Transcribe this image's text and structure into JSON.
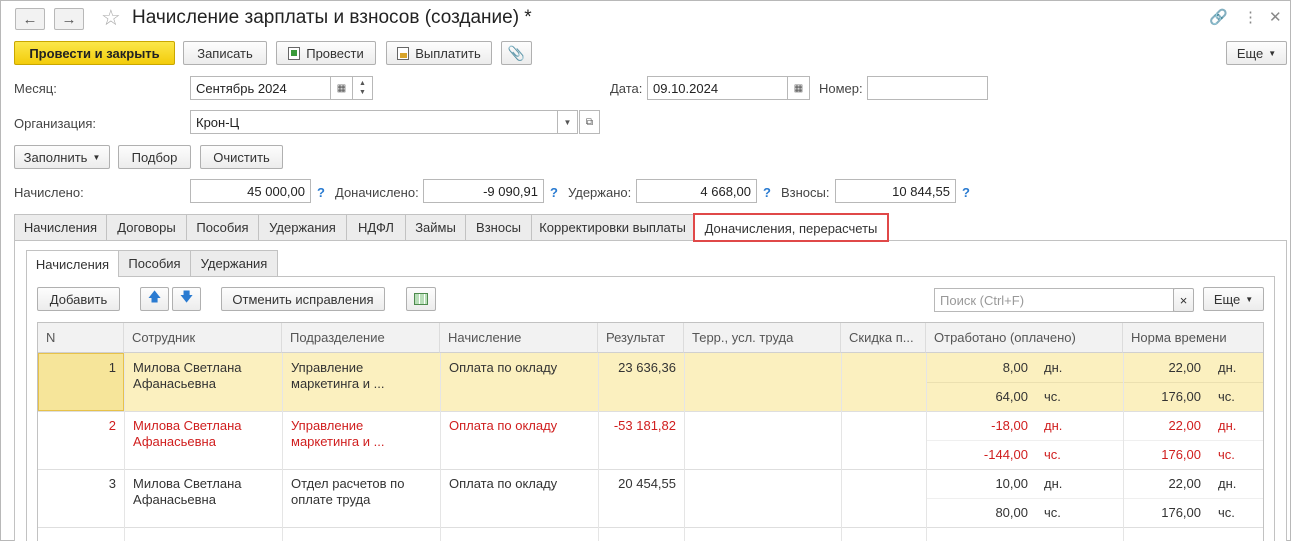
{
  "header": {
    "title": "Начисление зарплаты и взносов (создание) *",
    "icons": [
      "arrow-left-icon",
      "arrow-right-icon",
      "star-icon",
      "link-icon",
      "more-icon",
      "close-icon"
    ]
  },
  "toolbar": {
    "post_close": "Провести и закрыть",
    "save": "Записать",
    "post": "Провести",
    "pay": "Выплатить",
    "more": "Еще"
  },
  "form": {
    "month_label": "Месяц:",
    "month_value": "Сентябрь 2024",
    "date_label": "Дата:",
    "date_value": "09.10.2024",
    "number_label": "Номер:",
    "number_value": "",
    "org_label": "Организация:",
    "org_value": "Крон-Ц"
  },
  "actions": {
    "fill": "Заполнить",
    "select": "Подбор",
    "clear": "Очистить"
  },
  "totals": {
    "accrued_label": "Начислено:",
    "accrued_value": "45 000,00",
    "additional_label": "Доначислено:",
    "additional_value": "-9 090,91",
    "withheld_label": "Удержано:",
    "withheld_value": "4 668,00",
    "contrib_label": "Взносы:",
    "contrib_value": "10 844,55",
    "help": "?"
  },
  "tabs": [
    "Начисления",
    "Договоры",
    "Пособия",
    "Удержания",
    "НДФЛ",
    "Займы",
    "Взносы",
    "Корректировки выплаты",
    "Доначисления, перерасчеты"
  ],
  "subtabs": [
    "Начисления",
    "Пособия",
    "Удержания"
  ],
  "subtoolbar": {
    "add": "Добавить",
    "cancel_fix": "Отменить исправления",
    "search_placeholder": "Поиск (Ctrl+F)",
    "clear": "×",
    "more": "Еще"
  },
  "columns": [
    "N",
    "Сотрудник",
    "Подразделение",
    "Начисление",
    "Результат",
    "Терр., усл. труда",
    "Скидка п...",
    "Отработано (оплачено)",
    "Норма времени"
  ],
  "rows": [
    {
      "n": "1",
      "employee1": "Милова Светлана",
      "employee2": "Афанасьевна",
      "dept1": "Управление",
      "dept2": "маркетинга и ...",
      "accrual": "Оплата по окладу",
      "result": "23 636,36",
      "worked_days": "8,00",
      "u_days": "дн.",
      "worked_hours": "64,00",
      "u_hours": "чс.",
      "norm_days": "22,00",
      "nu_days": "дн.",
      "norm_hours": "176,00",
      "nu_hours": "чс."
    },
    {
      "n": "2",
      "employee1": "Милова Светлана",
      "employee2": "Афанасьевна",
      "dept1": "Управление",
      "dept2": "маркетинга и ...",
      "accrual": "Оплата по окладу",
      "result": "-53 181,82",
      "worked_days": "-18,00",
      "u_days": "дн.",
      "worked_hours": "-144,00",
      "u_hours": "чс.",
      "norm_days": "22,00",
      "nu_days": "дн.",
      "norm_hours": "176,00",
      "nu_hours": "чс."
    },
    {
      "n": "3",
      "employee1": "Милова Светлана",
      "employee2": "Афанасьевна",
      "dept1": "Отдел расчетов по",
      "dept2": "оплате труда",
      "accrual": "Оплата по окладу",
      "result": "20 454,55",
      "worked_days": "10,00",
      "u_days": "дн.",
      "worked_hours": "80,00",
      "u_hours": "чс.",
      "norm_days": "22,00",
      "nu_days": "дн.",
      "norm_hours": "176,00",
      "nu_hours": "чс."
    }
  ],
  "colors": {
    "primary_button": "#f3cc0b",
    "highlight": "#e04848",
    "selected_row": "#fbf0bf",
    "negative_text": "#d01e1e",
    "help_icon": "#2a7bd1"
  }
}
